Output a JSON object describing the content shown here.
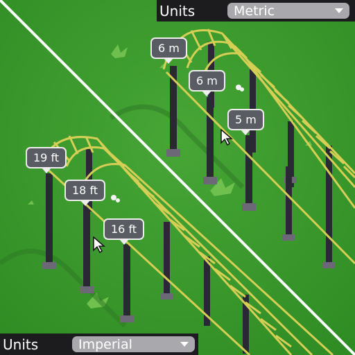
{
  "top_panel": {
    "units_label": "Units",
    "units_value": "Metric",
    "options_icon": "chevron-down-icon"
  },
  "bottom_panel": {
    "units_label": "Units",
    "units_value": "Imperial",
    "options_icon": "chevron-down-icon"
  },
  "metric_heights": [
    "6 m",
    "6 m",
    "5 m"
  ],
  "imperial_heights": [
    "19 ft",
    "18 ft",
    "16 ft"
  ],
  "colors": {
    "grass": "#3d9a2e",
    "track_rail": "#d6cf55",
    "support_pillar": "#2b2836",
    "pillar_base": "#6c6878",
    "divider": "#ffffff",
    "label_bg": "#5a5c64",
    "panel_bg": "#1c1c1e",
    "dropdown_bg": "#a9a9ad"
  }
}
